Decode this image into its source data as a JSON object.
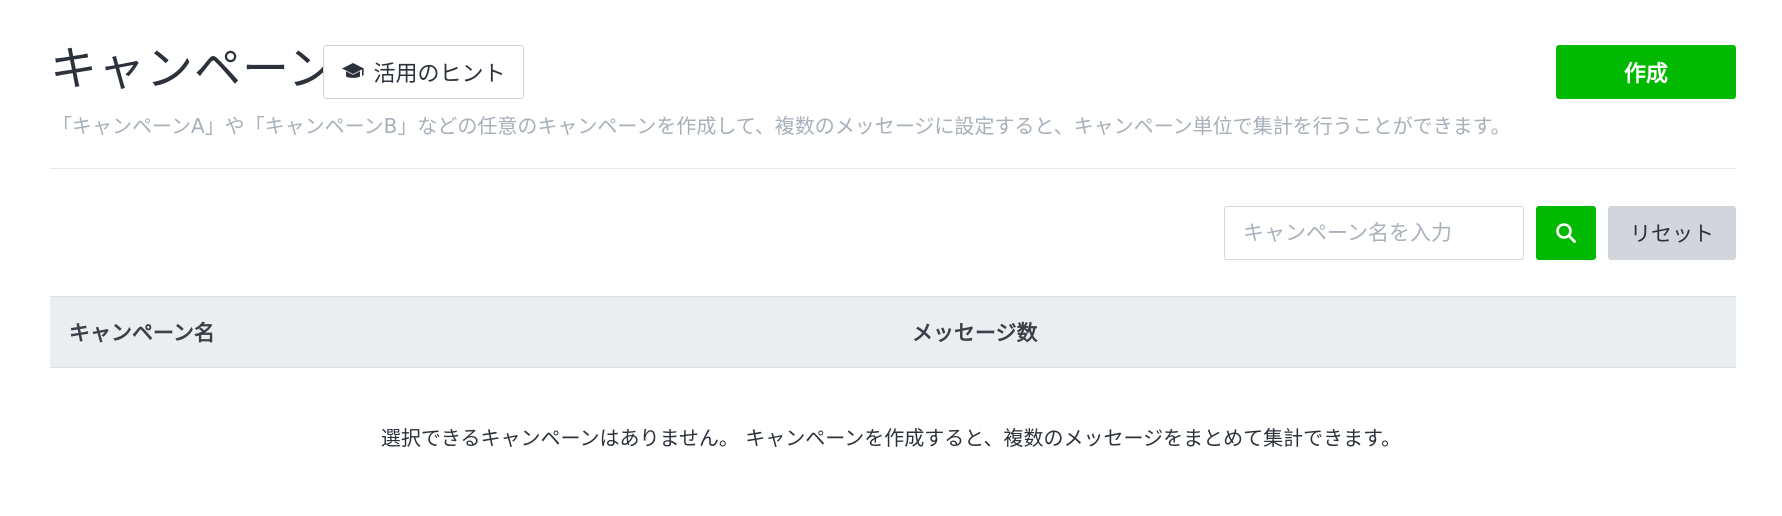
{
  "header": {
    "title": "キャンペーン",
    "hint_label": "活用のヒント",
    "hint_icon": "graduation-cap-icon",
    "create_label": "作成",
    "description": "「キャンペーンA」や「キャンペーンB」などの任意のキャンペーンを作成して、複数のメッセージに設定すると、キャンペーン単位で集計を行うことができます。"
  },
  "search": {
    "placeholder": "キャンペーン名を入力",
    "value": "",
    "search_icon": "search-icon",
    "reset_label": "リセット"
  },
  "table": {
    "columns": [
      "キャンペーン名",
      "メッセージ数"
    ],
    "rows": [],
    "empty_message": "選択できるキャンペーンはありません。 キャンペーンを作成すると、複数のメッセージをまとめて集計できます。"
  },
  "colors": {
    "accent": "#00b900",
    "muted_text": "#a7b0bb",
    "header_bg": "#ebeef0",
    "reset_bg": "#d2d6db"
  }
}
